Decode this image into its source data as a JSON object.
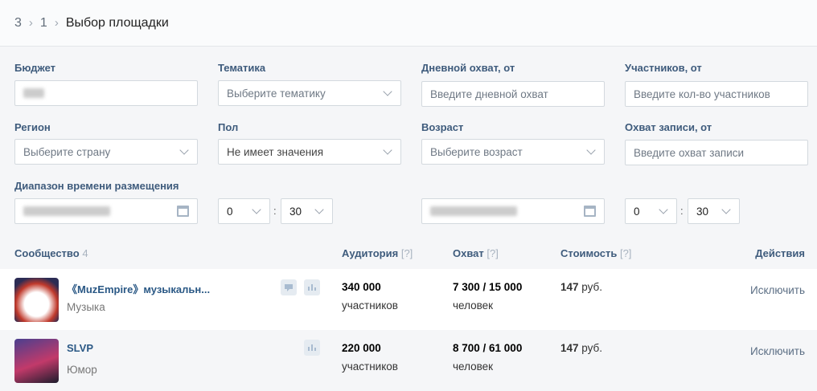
{
  "breadcrumb": {
    "items": [
      "3",
      "1"
    ],
    "current": "Выбор площадки"
  },
  "filters": {
    "budget": {
      "label": "Бюджет"
    },
    "topic": {
      "label": "Тематика",
      "placeholder": "Выберите тематику"
    },
    "daily_reach": {
      "label": "Дневной охват, от",
      "placeholder": "Введите дневной охват"
    },
    "members": {
      "label": "Участников, от",
      "placeholder": "Введите кол-во участников"
    },
    "region": {
      "label": "Регион",
      "placeholder": "Выберите страну"
    },
    "gender": {
      "label": "Пол",
      "value": "Не имеет значения"
    },
    "age": {
      "label": "Возраст",
      "placeholder": "Выберите возраст"
    },
    "post_reach": {
      "label": "Охват записи, от",
      "placeholder": "Введите охват записи"
    },
    "time_range": {
      "label": "Диапазон времени размещения",
      "from_hour": "0",
      "from_min": "30",
      "to_hour": "0",
      "to_min": "30",
      "colon": ":"
    }
  },
  "table": {
    "headers": {
      "community": "Сообщество",
      "count": "4",
      "audience": "Аудитория",
      "reach": "Охват",
      "cost": "Стоимость",
      "actions": "Действия",
      "help": "[?]"
    },
    "rows": [
      {
        "name": "《MuzEmpire》музыкальн...",
        "category": "Музыка",
        "audience": "340 000",
        "audience_unit": "участников",
        "reach": "7 300 / 15 000",
        "reach_unit": "человек",
        "cost": "147",
        "cost_unit": "руб.",
        "action": "Исключить",
        "icons": [
          "comment-icon",
          "stats-icon"
        ]
      },
      {
        "name": "SLVP",
        "category": "Юмор",
        "audience": "220 000",
        "audience_unit": "участников",
        "reach": "8 700 / 61 000",
        "reach_unit": "человек",
        "cost": "147",
        "cost_unit": "руб.",
        "action": "Исключить",
        "icons": [
          "stats-icon"
        ]
      }
    ]
  }
}
